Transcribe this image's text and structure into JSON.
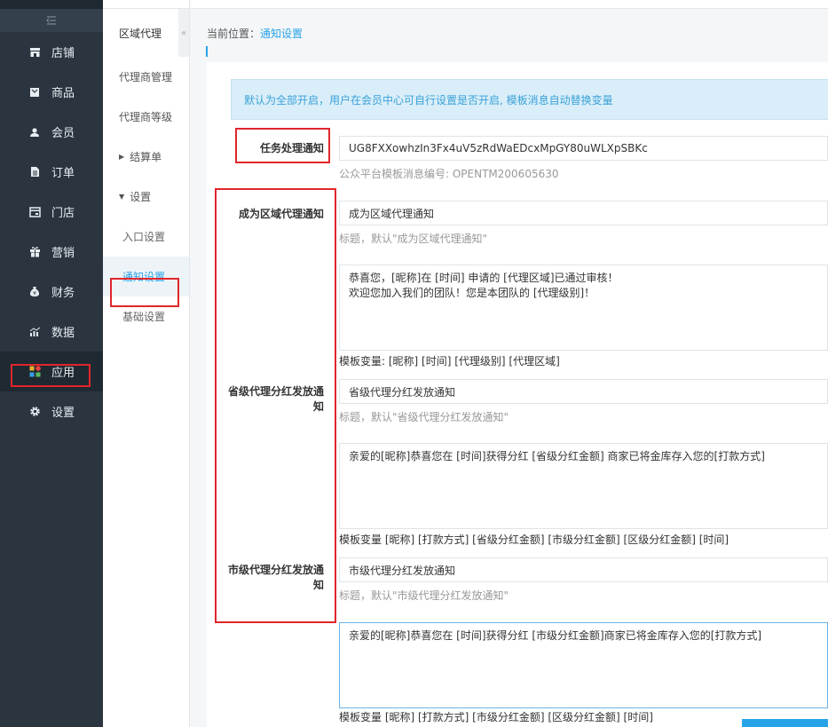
{
  "sidebar": {
    "items": [
      {
        "label": "店铺",
        "icon": "store-icon"
      },
      {
        "label": "商品",
        "icon": "goods-icon"
      },
      {
        "label": "会员",
        "icon": "member-icon"
      },
      {
        "label": "订单",
        "icon": "order-icon"
      },
      {
        "label": "门店",
        "icon": "shop-icon"
      },
      {
        "label": "营销",
        "icon": "gift-icon"
      },
      {
        "label": "财务",
        "icon": "money-bag-icon"
      },
      {
        "label": "数据",
        "icon": "chart-icon"
      },
      {
        "label": "应用",
        "icon": "apps-icon"
      },
      {
        "label": "设置",
        "icon": "gear-icon"
      }
    ]
  },
  "subnav": {
    "title": "区域代理",
    "items": [
      {
        "label": "代理商管理"
      },
      {
        "label": "代理商等级"
      },
      {
        "label": "结算单"
      },
      {
        "label": "设置"
      },
      {
        "label": "入口设置"
      },
      {
        "label": "通知设置"
      },
      {
        "label": "基础设置"
      }
    ]
  },
  "breadcrumb": {
    "prefix": "当前位置：",
    "current": "通知设置"
  },
  "info": "默认为全部开启，用户在会员中心可自行设置是否开启, 模板消息自动替换变量",
  "task": {
    "label": "任务处理通知",
    "value": "UG8FXXowhzIn3Fx4uV5zRdWaEDcxMpGY80uWLXpSBKc",
    "hint": "公众平台模板消息编号: OPENTM200605630"
  },
  "become": {
    "label": "成为区域代理通知",
    "value": "成为区域代理通知",
    "hint": "标题，默认\"成为区域代理通知\"",
    "content_line1": "恭喜您，[昵称]在 [时间] 申请的 [代理区域]已通过审核！",
    "content_line2": "欢迎您加入我们的团队！您是本团队的 [代理级别]！",
    "vars": "模板变量: [昵称] [时间] [代理级别] [代理区域]"
  },
  "province": {
    "label_line1": "省级代理分红发放通",
    "label_line2": "知",
    "value": "省级代理分红发放通知",
    "hint": "标题，默认\"省级代理分红发放通知\"",
    "content": "亲爱的[昵称]恭喜您在 [时间]获得分红 [省级分红金额] 商家已将金库存入您的[打款方式]",
    "vars": "模板变量 [昵称] [打款方式] [省级分红金额] [市级分红金额] [区级分红金额] [时间]"
  },
  "city": {
    "label_line1": "市级代理分红发放通",
    "label_line2": "知",
    "value": "市级代理分红发放通知",
    "hint": "标题，默认\"市级代理分红发放通知\"",
    "content": "亲爱的[昵称]恭喜您在 [时间]获得分红 [市级分红金额]商家已将金库存入您的[打款方式]",
    "vars": "模板变量 [昵称] [打款方式] [市级分红金额] [区级分红金额] [时间]"
  }
}
